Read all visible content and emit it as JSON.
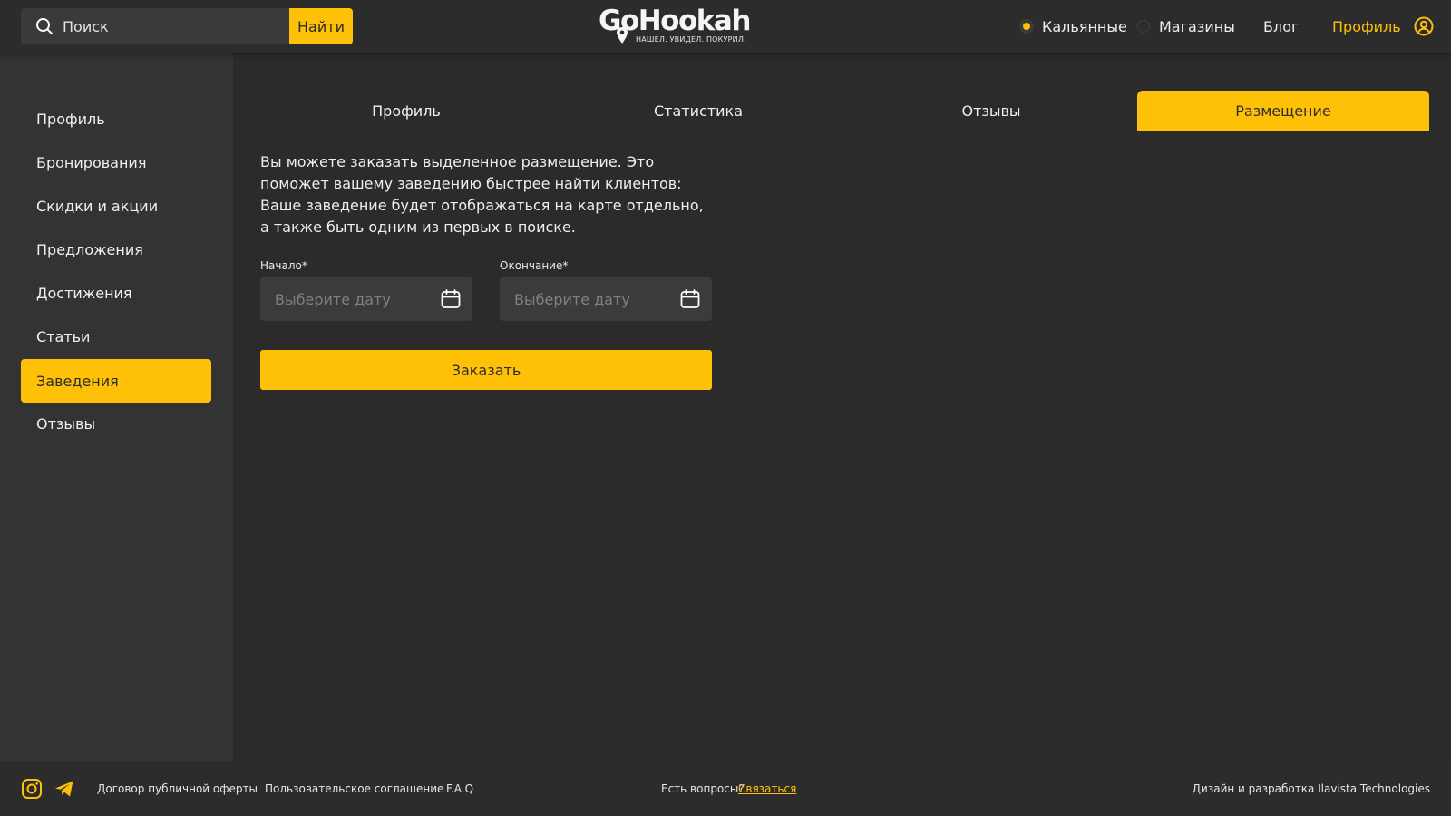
{
  "header": {
    "search_placeholder": "Поиск",
    "search_button": "Найти",
    "logo_text": "GoHookah",
    "logo_tagline": "НАШЕЛ. УВИДЕЛ. ПОКУРИЛ.",
    "nav": {
      "hookahs": "Кальянные",
      "hookahs_selected": true,
      "shops": "Магазины",
      "shops_selected": false,
      "blog": "Блог",
      "profile": "Профиль"
    }
  },
  "sidebar": {
    "items": [
      {
        "label": "Профиль"
      },
      {
        "label": "Бронирования"
      },
      {
        "label": "Скидки и акции"
      },
      {
        "label": "Предложения"
      },
      {
        "label": "Достижения"
      },
      {
        "label": "Статьи"
      },
      {
        "label": "Заведения",
        "active": true
      },
      {
        "label": "Отзывы"
      }
    ]
  },
  "main": {
    "tabs": [
      {
        "label": "Профиль"
      },
      {
        "label": "Статистика"
      },
      {
        "label": "Отзывы"
      },
      {
        "label": "Размещение",
        "active": true
      }
    ],
    "description": "Вы можете заказать выделенное размещение. Это поможет вашему заведению быстрее найти клиентов: Ваше заведение будет отображаться на карте отдельно, а также быть одним из первых в поиске.",
    "start": {
      "label": "Начало*",
      "placeholder": "Выберите дату",
      "value": ""
    },
    "end": {
      "label": "Окончание*",
      "placeholder": "Выберите дату",
      "value": ""
    },
    "order_button": "Заказать"
  },
  "footer": {
    "offer": "Договор публичной оферты",
    "agreement": "Пользовательское соглашение",
    "faq": "F.A.Q",
    "question": "Есть вопросы?",
    "contact": "Связаться",
    "credits": "Дизайн и разработка Ilavista Technologies"
  },
  "colors": {
    "accent": "#ffc107",
    "background": "#2b2b2b",
    "sidebar": "#333333",
    "input": "#3b3b3b"
  }
}
